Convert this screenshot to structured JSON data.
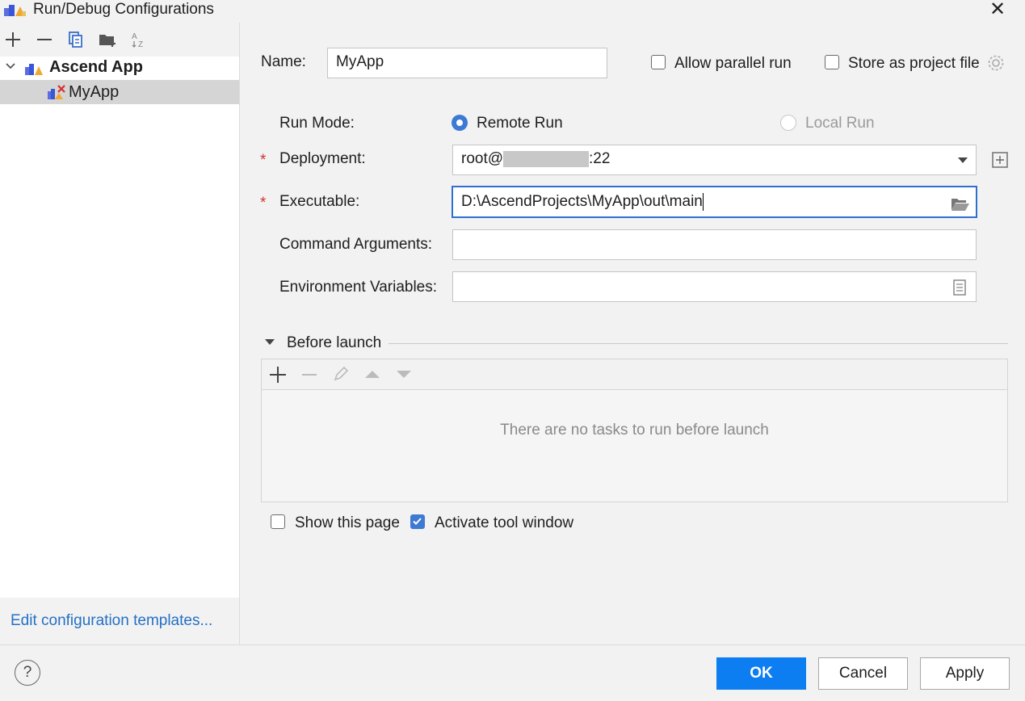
{
  "window": {
    "title": "Run/Debug Configurations",
    "close_icon": "close-icon"
  },
  "left_toolbar": {
    "icons": [
      "add-icon",
      "remove-icon",
      "copy-icon",
      "folder-add-icon",
      "sort-alpha-icon"
    ]
  },
  "tree": {
    "root": {
      "label": "Ascend App",
      "expanded": true
    },
    "children": [
      {
        "label": "MyApp",
        "selected": true
      }
    ]
  },
  "left_footer": {
    "edit_templates": "Edit configuration templates..."
  },
  "form": {
    "name_label": "Name:",
    "name_value": "MyApp",
    "allow_parallel_label": "Allow parallel run",
    "allow_parallel_checked": false,
    "store_project_label": "Store as project file",
    "store_project_checked": false,
    "run_mode_label": "Run Mode:",
    "remote_run_label": "Remote Run",
    "remote_run_selected": true,
    "local_run_label": "Local Run",
    "local_run_enabled": false,
    "required_marker": "*",
    "deployment_label": "Deployment:",
    "deployment_value_prefix": "root@",
    "deployment_value_suffix": ":22",
    "executable_label": "Executable:",
    "executable_value": "D:\\AscendProjects\\MyApp\\out\\main",
    "cmd_args_label": "Command Arguments:",
    "cmd_args_value": "",
    "env_vars_label": "Environment Variables:",
    "env_vars_value": ""
  },
  "before_launch": {
    "title": "Before launch",
    "empty_text": "There are no tasks to run before launch",
    "toolbar_icons": [
      "add-icon",
      "remove-icon",
      "edit-icon",
      "move-up-icon",
      "move-down-icon"
    ]
  },
  "options": {
    "show_page_label": "Show this page",
    "show_page_checked": false,
    "activate_tool_label": "Activate tool window",
    "activate_tool_checked": true
  },
  "buttons": {
    "help": "?",
    "ok": "OK",
    "cancel": "Cancel",
    "apply": "Apply"
  },
  "colors": {
    "accent": "#0d7df2",
    "link": "#2470c6",
    "required": "#d13434",
    "selection": "#d5d5d5"
  }
}
